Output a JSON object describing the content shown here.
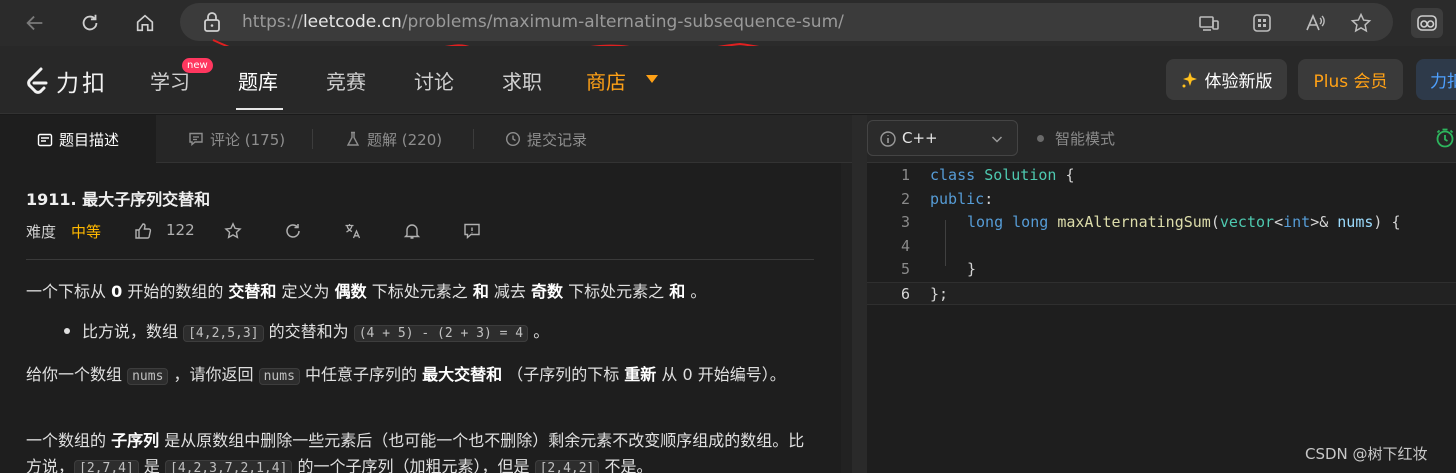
{
  "browser": {
    "url_scheme": "https://",
    "url_host": "leetcode.cn",
    "url_path": "/problems/maximum-alternating-subsequence-sum/",
    "annotation_color": "#e02020"
  },
  "header": {
    "logo_text": "力扣",
    "nav": [
      {
        "label": "学习",
        "badge": "new"
      },
      {
        "label": "题库"
      },
      {
        "label": "竞赛"
      },
      {
        "label": "讨论"
      },
      {
        "label": "求职"
      },
      {
        "label": "商店"
      }
    ],
    "try_new_label": "体验新版",
    "plus_label": "Plus 会员",
    "cut_label": "力扣",
    "accent_color": "#ffa116"
  },
  "tabs": [
    {
      "label": "题目描述",
      "icon": "description-icon"
    },
    {
      "label": "评论 (175)",
      "icon": "comment-icon"
    },
    {
      "label": "题解 (220)",
      "icon": "flask-icon"
    },
    {
      "label": "提交记录",
      "icon": "history-icon"
    }
  ],
  "problem": {
    "title": "1911. 最大子序列交替和",
    "difficulty_label": "难度",
    "difficulty": "中等",
    "likes": "122",
    "difficulty_color": "#ffb800"
  },
  "description": {
    "p1": [
      "一个下标从 ",
      "0",
      " 开始的数组的 ",
      "交替和",
      " 定义为 ",
      "偶数",
      " 下标处元素之 ",
      "和",
      " 减去 ",
      "奇数",
      " 下标处元素之 ",
      "和",
      " 。"
    ],
    "bullet": [
      "比方说，数组 ",
      "[4,2,5,3]",
      " 的交替和为 ",
      "(4 + 5) - (2 + 3) = 4",
      " 。"
    ],
    "p2": [
      "给你一个数组 ",
      "nums",
      " ，请你返回 ",
      "nums",
      " 中任意子序列的 ",
      "最大交替和",
      " （子序列的下标 ",
      "重新",
      " 从 0 开始编号）。"
    ],
    "p3": [
      "一个数组的 ",
      "子序列",
      " 是从原数组中删除一些元素后（也可能一个也不删除）剩余元素不改变顺序组成的数组。比方说，",
      "[2,7,4]",
      " 是 ",
      "[4,2,3,7,2,1,4]",
      " 的一个子序列（加粗元素），但是 ",
      "[2,4,2]",
      " 不是。"
    ]
  },
  "editor": {
    "language": "C++",
    "mode_label": "智能模式",
    "line_numbers": [
      "1",
      "2",
      "3",
      "4",
      "5",
      "6"
    ],
    "code": {
      "l1_kw": "class",
      "l1_ty": "Solution",
      "l1_rest": " {",
      "l2_kw": "public",
      "l2_rest": ":",
      "l3_kw": "long long",
      "l3_fn": "maxAlternatingSum",
      "l3_p1": "(",
      "l3_ty": "vector",
      "l3_p2": "<",
      "l3_kw2": "int",
      "l3_p3": ">& ",
      "l3_vr": "nums",
      "l3_p4": ") {",
      "l5": "}",
      "l6": "};"
    }
  },
  "watermark": "CSDN @树下红妆"
}
